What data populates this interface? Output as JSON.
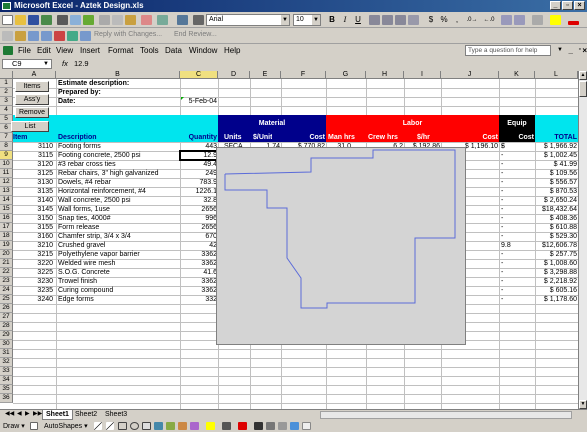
{
  "window": {
    "title": "Microsoft Excel - Aztek Design.xls"
  },
  "toolbar": {
    "font_name": "Arial",
    "font_size": "10",
    "reply_text": "Reply with Changes...",
    "end_review_text": "End Review...",
    "bold": "B",
    "italic": "I",
    "underline": "U",
    "currency": "$",
    "percent": "%",
    "comma": ",",
    "inc_decimal": ".0→",
    "dec_decimal": "←.0"
  },
  "menubar": {
    "items": [
      "File",
      "Edit",
      "View",
      "Insert",
      "Format",
      "Tools",
      "Data",
      "Window",
      "Help"
    ],
    "help_placeholder": "Type a question for help"
  },
  "formula_bar": {
    "cell_ref": "C9",
    "fx": "fx",
    "value": "12.9"
  },
  "columns": [
    "A",
    "B",
    "C",
    "D",
    "E",
    "F",
    "G",
    "H",
    "I",
    "J",
    "K",
    "L"
  ],
  "rows": [
    "1",
    "2",
    "3",
    "4",
    "5",
    "6",
    "7",
    "8",
    "9",
    "10",
    "11",
    "12",
    "13",
    "14",
    "15",
    "16",
    "17",
    "18",
    "19",
    "20",
    "21",
    "22",
    "23",
    "24",
    "25",
    "26",
    "27",
    "28",
    "29",
    "30",
    "31",
    "32",
    "33",
    "34",
    "35",
    "36"
  ],
  "buttons": {
    "items": "Items",
    "assy": "Ass'y",
    "remove": "Remove",
    "list": "List"
  },
  "header": {
    "estimate_description": "Estimate description:",
    "prepared_by": "Prepared by:",
    "date_label": "Date:",
    "date_value": "5-Feb-04"
  },
  "bands": {
    "material": "Material",
    "labor": "Labor",
    "equip": "Equip"
  },
  "col_headers": {
    "item": "Item",
    "description": "Description",
    "quantity": "Quantity",
    "units": "Units",
    "per_unit": "$/Unit",
    "cost": "Cost",
    "man_hrs": "Man hrs",
    "crew_hrs": "Crew hrs",
    "per_hr": "$/hr",
    "labor_cost": "Cost",
    "equip_cost": "Cost",
    "total": "TOTAL"
  },
  "line_items": [
    {
      "item": "3110",
      "desc": "Footing forms",
      "qty": "443",
      "equip": "-",
      "total": "$ 1,966.92"
    },
    {
      "item": "3115",
      "desc": "Footing concrete, 2500 psi",
      "qty": "12.9",
      "equip": "-",
      "total": "$ 1,002.45"
    },
    {
      "item": "3120",
      "desc": "#3 rebar cross ties",
      "qty": "49.4",
      "equip": "-",
      "total": "$ 41.99"
    },
    {
      "item": "3125",
      "desc": "Rebar chairs, 3\" high galvanized",
      "qty": "249",
      "equip": "-",
      "total": "$ 109.56"
    },
    {
      "item": "3130",
      "desc": "Dowels, #4 rebar",
      "qty": "783.9",
      "equip": "-",
      "total": "$ 556.57"
    },
    {
      "item": "3135",
      "desc": "Horizontal reinforcement, #4",
      "qty": "1226.1",
      "equip": "-",
      "total": "$ 870.53"
    },
    {
      "item": "3140",
      "desc": "Wall concrete, 2500 psi",
      "qty": "32.8",
      "equip": "-",
      "total": "$ 2,650.24"
    },
    {
      "item": "3145",
      "desc": "Wall forms, 1use",
      "qty": "2656",
      "equip": "-",
      "total": "$18,432.64"
    },
    {
      "item": "3150",
      "desc": "Snap ties, 4000#",
      "qty": "996",
      "equip": "-",
      "total": "$ 408.36"
    },
    {
      "item": "3155",
      "desc": "Form release",
      "qty": "2656",
      "equip": "-",
      "total": "$ 610.88"
    },
    {
      "item": "3160",
      "desc": "Chamfer strip, 3/4 x 3/4",
      "qty": "670",
      "equip": "-",
      "total": "$ 529.30"
    },
    {
      "item": "3210",
      "desc": "Crushed gravel",
      "qty": "42",
      "equip": "9.88",
      "total": "$12,606.78"
    },
    {
      "item": "3215",
      "desc": "Polyethylene vapor barrier",
      "qty": "3362",
      "equip": "-",
      "total": "$ 257.75"
    },
    {
      "item": "3220",
      "desc": "Welded wire mesh",
      "qty": "3362",
      "equip": "-",
      "total": "$ 1,008.60"
    },
    {
      "item": "3225",
      "desc": "S.O.G. Concrete",
      "qty": "41.6",
      "equip": "-",
      "total": "$ 3,298.88"
    },
    {
      "item": "3230",
      "desc": "Trowel finish",
      "qty": "3362",
      "equip": "-",
      "total": "$ 2,218.92"
    },
    {
      "item": "3235",
      "desc": "Curing compound",
      "qty": "3362",
      "equip": "-",
      "total": "$ 605.16"
    },
    {
      "item": "3240",
      "desc": "Edge forms",
      "qty": "332",
      "equip": "-",
      "total": "$ 1,178.60"
    }
  ],
  "row8_detail": {
    "units": "SFCA",
    "per_unit": "1.74",
    "cost": "$ 770.82",
    "man_hrs": "31.0",
    "crew_hrs": "6.2",
    "per_hr": "$ 192.86",
    "labor_cost": "$ 1,196.10",
    "equip_cost": "$"
  },
  "tabs": {
    "sheet1": "Sheet1",
    "sheet2": "Sheet2",
    "sheet3": "Sheet3"
  },
  "drawbar": {
    "draw": "Draw ▾",
    "autoshapes": "AutoShapes ▾"
  },
  "colors": {
    "material_band": "#00008b",
    "labor_band": "#ff0000",
    "equip_band": "#000000",
    "header_band": "#00e5ee",
    "outline": "#5b6bd9"
  }
}
